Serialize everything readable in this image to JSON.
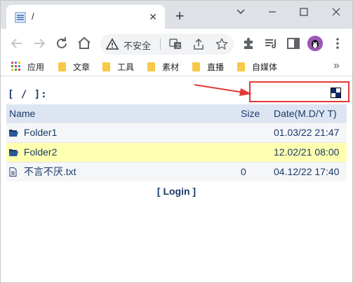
{
  "browser": {
    "tab_title": "/",
    "omnibox_security": "不安全",
    "bookmarks": [
      {
        "label": "应用"
      },
      {
        "label": "文章"
      },
      {
        "label": "工具"
      },
      {
        "label": "素材"
      },
      {
        "label": "直播"
      },
      {
        "label": "自媒体"
      }
    ],
    "bookmarks_more": "»",
    "new_tab": "+",
    "tab_close": "✕"
  },
  "page": {
    "path_title": "[ / ]:",
    "table": {
      "headers": {
        "name": "Name",
        "size": "Size",
        "date": "Date(M.D/Y T)"
      },
      "rows": [
        {
          "type": "folder",
          "name": "Folder1",
          "size": "",
          "date": "01.03/22 21:47"
        },
        {
          "type": "folder",
          "name": "Folder2",
          "size": "",
          "date": "12.02/21 08:00"
        },
        {
          "type": "file",
          "name": "不言不厌.txt",
          "size": "0",
          "date": "04.12/22 17:40"
        }
      ]
    },
    "login_label": "[ Login ]"
  },
  "colors": {
    "link": "#1a3a6a",
    "header_bg": "#dde5f3",
    "highlight_row": "#ffffb0",
    "annotation_red": "#e53935"
  }
}
